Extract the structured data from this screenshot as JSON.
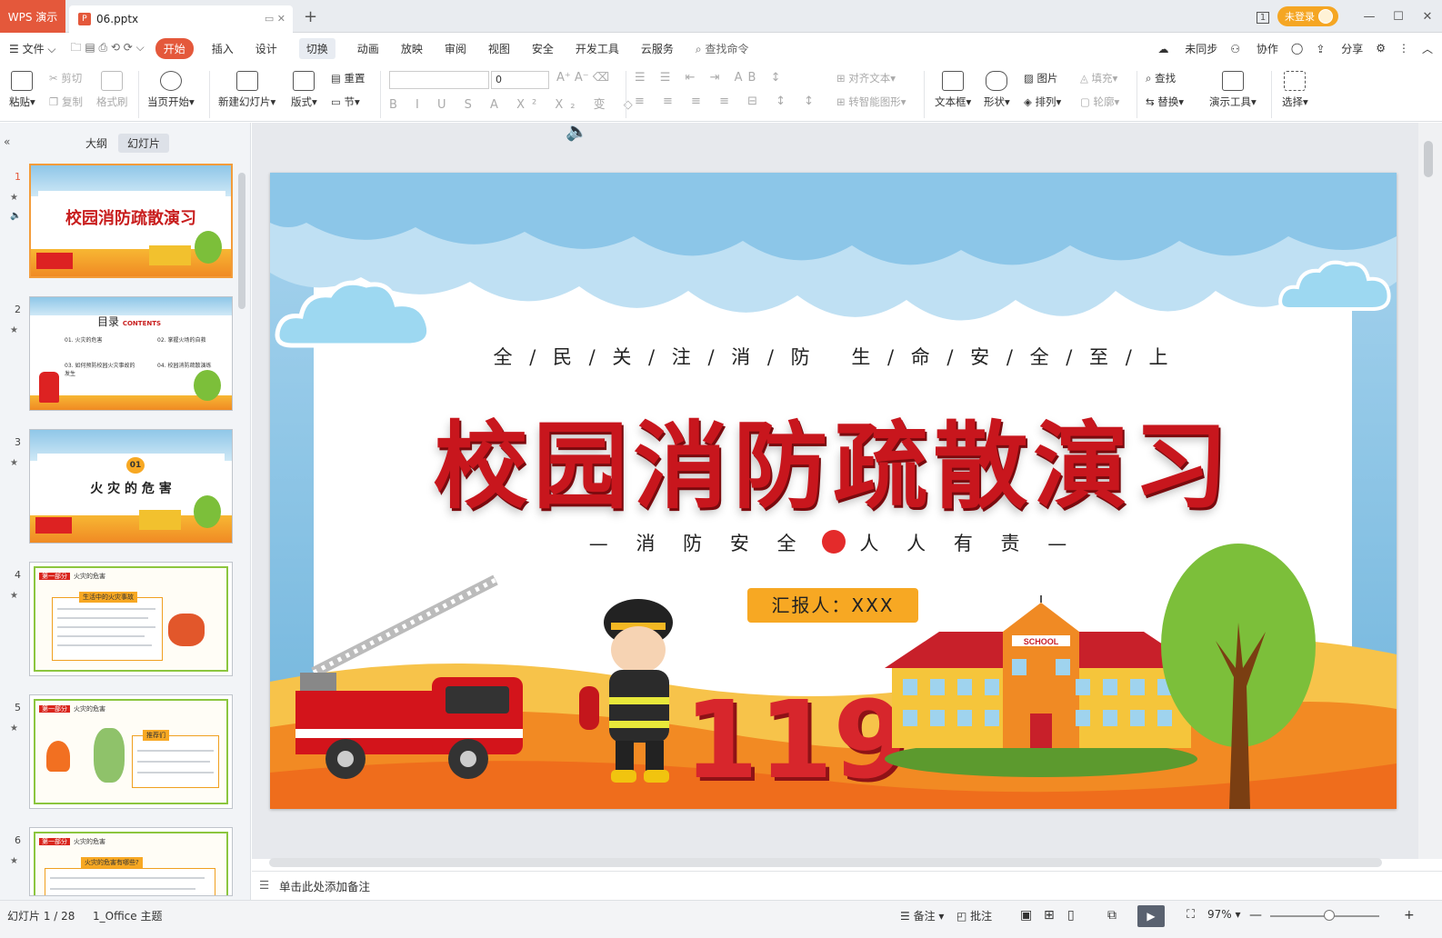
{
  "titlebar": {
    "app_tab": "WPS 演示",
    "doc_tab": "06.pptx",
    "new_tab": "+",
    "login_label": "未登录",
    "page_badge": "1"
  },
  "menubar": {
    "items": [
      "文件",
      "开始",
      "插入",
      "设计",
      "切换",
      "动画",
      "放映",
      "审阅",
      "视图",
      "安全",
      "开发工具",
      "云服务"
    ],
    "search": "查找命令",
    "right": [
      "未同步",
      "协作",
      "分享"
    ]
  },
  "ribbon": {
    "paste": "粘贴",
    "cut": "剪切",
    "copy": "复制",
    "format_painter": "格式刷",
    "from_current": "当页开始",
    "new_slide": "新建幻灯片",
    "layout": "版式",
    "reset": "重置",
    "section": "节",
    "font_size": "0",
    "align_text": "对齐文本",
    "smartart": "转智能图形",
    "textbox": "文本框",
    "shape": "形状",
    "picture": "图片",
    "arrange": "排列",
    "fill": "填充",
    "outline": "轮廓",
    "find": "查找",
    "replace": "替换",
    "present_tools": "演示工具",
    "select": "选择"
  },
  "left_panel": {
    "tab_outline": "大纲",
    "tab_slides": "幻灯片",
    "thumbnails": [
      {
        "num": "1",
        "title": "校园消防疏散演习"
      },
      {
        "num": "2",
        "title": "目录",
        "title_en": "CONTENTS",
        "items": [
          "01. 火灾的危害",
          "02. 掌握火场的自救",
          "03. 如何预防校园火灾事故的发生",
          "04. 校园消防疏散演练"
        ]
      },
      {
        "num": "3",
        "badge": "01",
        "title": "火 灾 的 危 害"
      },
      {
        "num": "4",
        "section": "第一部分",
        "head": "火灾的危害",
        "box_title": "生活中的火灾事故"
      },
      {
        "num": "5",
        "section": "第一部分",
        "head": "火灾的危害",
        "box_title": "推荐们"
      },
      {
        "num": "6",
        "section": "第一部分",
        "head": "火灾的危害",
        "box_title": "火灾的危害有哪些?"
      }
    ]
  },
  "slide": {
    "slogan": "全 / 民 / 关 / 注 / 消 / 防　 生 / 命 / 安 / 全 / 至 / 上",
    "title": "校园消防疏散演习",
    "slogan2_left": "— 消 防 安 全",
    "slogan2_right": "人 人 有 责 —",
    "reporter": "汇报人：XXX",
    "school_sign": "SCHOOL",
    "number": "119"
  },
  "notes": {
    "placeholder": "单击此处添加备注"
  },
  "status": {
    "slide_count": "幻灯片 1 / 28",
    "theme": "1_Office 主题",
    "notes_btn": "备注",
    "comment_btn": "批注",
    "zoom": "97%"
  },
  "colors": {
    "accent": "#e4583b",
    "title_red": "#c8161d",
    "reporter_bg": "#f7a823"
  }
}
